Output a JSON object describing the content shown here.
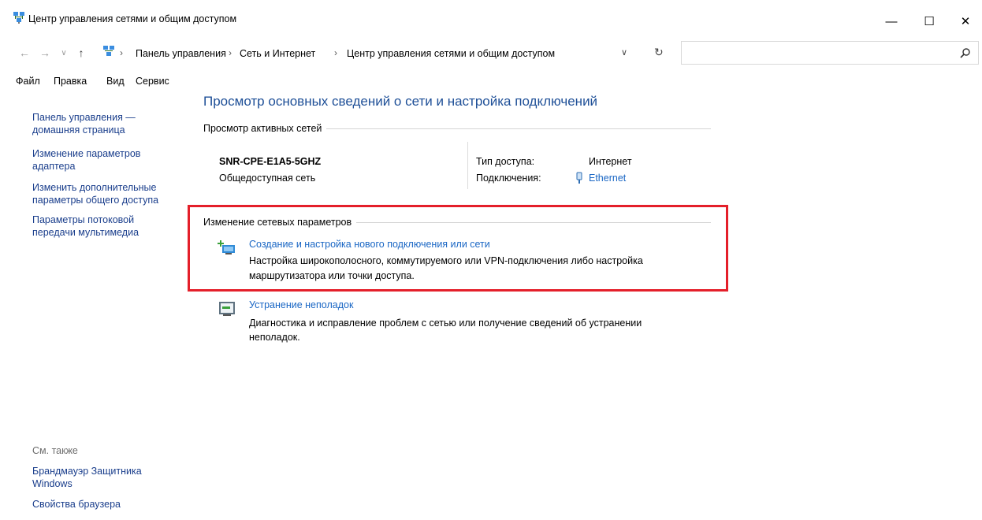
{
  "window": {
    "title": "Центр управления сетями и общим доступом",
    "minimize": "—",
    "maximize": "☐",
    "close": "✕"
  },
  "address": {
    "breadcrumb": [
      "Панель управления",
      "Сеть и Интернет",
      "Центр управления сетями и общим доступом"
    ],
    "separator": "›",
    "search_placeholder": ""
  },
  "menu": {
    "items": [
      "Файл",
      "Правка",
      "Вид",
      "Сервис"
    ]
  },
  "sidebar": {
    "home_link_line1": "Панель управления —",
    "home_link_line2": "домашняя страница",
    "links": [
      {
        "line1": "Изменение параметров",
        "line2": "адаптера"
      },
      {
        "line1": "Изменить дополнительные",
        "line2": "параметры общего доступа"
      },
      {
        "line1": "Параметры потоковой",
        "line2": "передачи мультимедиа"
      }
    ],
    "see_also": "См. также",
    "see_also_links": [
      {
        "line1": "Брандмауэр Защитника",
        "line2": "Windows"
      },
      {
        "line1": "Свойства браузера",
        "line2": ""
      }
    ]
  },
  "main": {
    "title": "Просмотр основных сведений о сети и настройка подключений",
    "active_networks_label": "Просмотр активных сетей",
    "network_name": "SNR-CPE-E1A5-5GHZ",
    "network_type": "Общедоступная сеть",
    "access_type_label": "Тип доступа:",
    "access_type_value": "Интернет",
    "connections_label": "Подключения:",
    "connections_value": "Ethernet",
    "change_settings_label": "Изменение сетевых параметров",
    "new_connection_link": "Создание и настройка нового подключения или сети",
    "new_connection_desc1": "Настройка широкополосного, коммутируемого или VPN-подключения либо настройка",
    "new_connection_desc2": "маршрутизатора или точки доступа.",
    "troubleshoot_link": "Устранение неполадок",
    "troubleshoot_desc1": "Диагностика и исправление проблем с сетью или получение сведений об устранении",
    "troubleshoot_desc2": "неполадок."
  },
  "colors": {
    "link": "#1966c4",
    "title": "#1e4f97",
    "highlight": "#e41f2a"
  }
}
